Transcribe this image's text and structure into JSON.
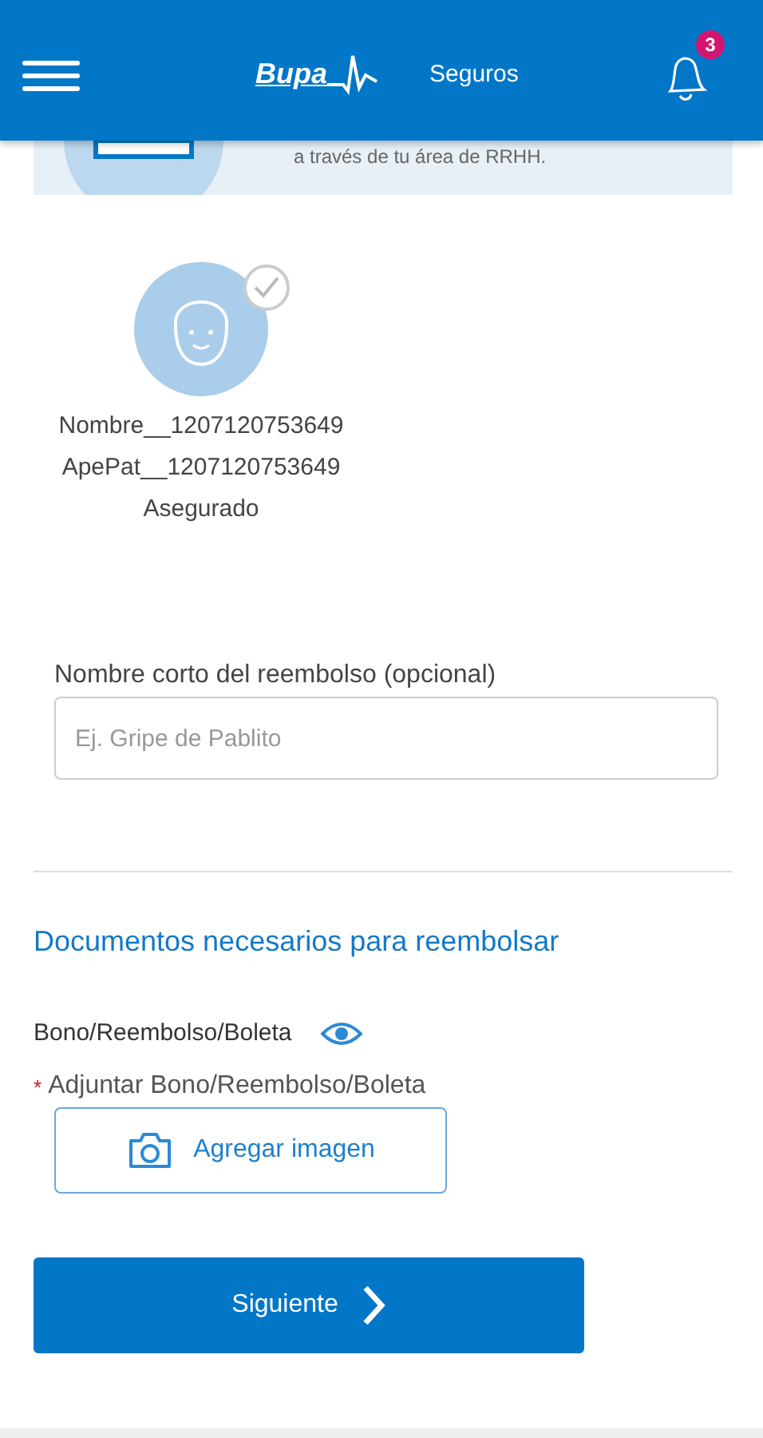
{
  "header": {
    "brand": "Bupa",
    "subtitle": "Seguros",
    "notifications": "3"
  },
  "banner": {
    "text": "a través de tu área de RRHH."
  },
  "beneficiary": {
    "name": "Nombre__1207120753649",
    "surname": "ApePat__1207120753649",
    "role": "Asegurado",
    "checked": false
  },
  "short_name": {
    "label": "Nombre corto del reembolso (opcional)",
    "placeholder": "Ej. Gripe de Pablito"
  },
  "documents": {
    "title": "Documentos necesarios para reembolsar",
    "items": [
      {
        "name": "Bono/Reembolso/Boleta",
        "required_mark": "*",
        "attach_label": "Adjuntar Bono/Reembolso/Boleta",
        "button": "Agregar imagen"
      }
    ]
  },
  "next_button": "Siguiente"
}
